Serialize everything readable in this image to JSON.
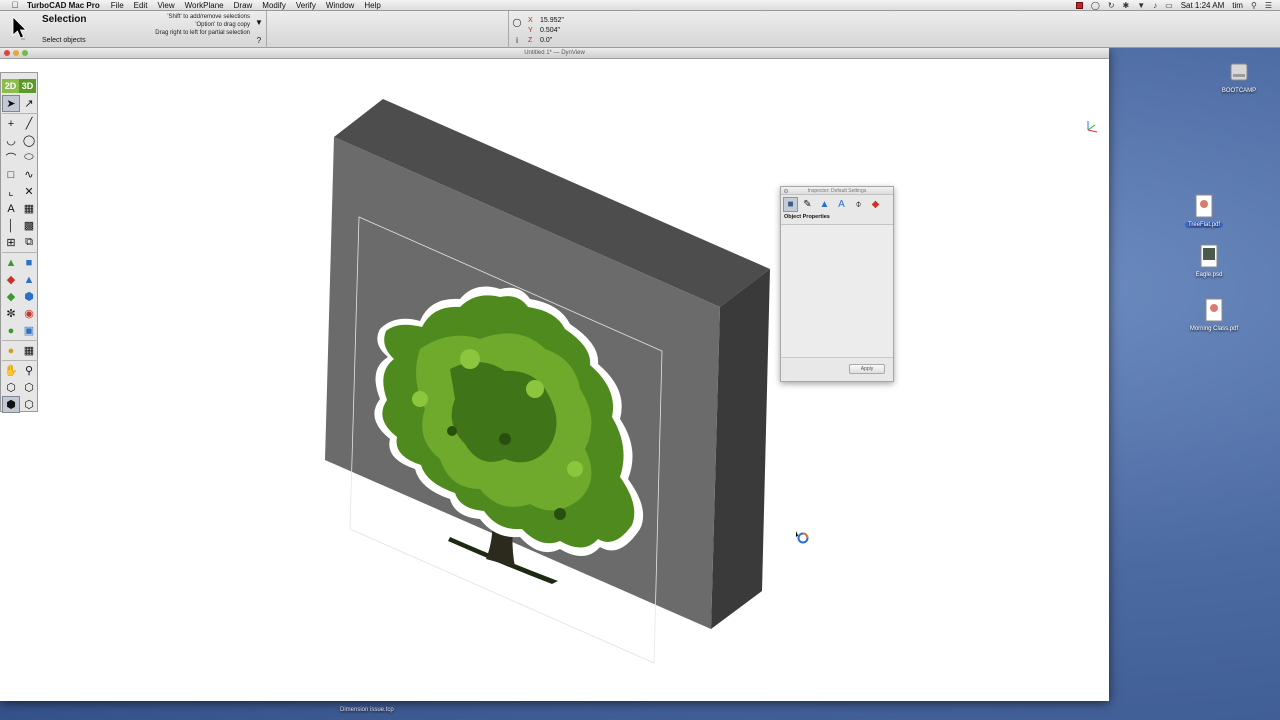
{
  "menubar": {
    "app_name": "TurboCAD Mac Pro",
    "menus": [
      "File",
      "Edit",
      "View",
      "WorkPlane",
      "Draw",
      "Modify",
      "Verify",
      "Window",
      "Help"
    ],
    "clock": "Sat 1:24 AM",
    "user": "tim"
  },
  "toolbar": {
    "tool_title": "Selection",
    "tool_subtitle": "Select objects",
    "hints": [
      "'Shift' to add/remove selections",
      "'Option' to drag copy",
      "Drag right to left for partial selection"
    ],
    "coords": [
      {
        "label": "X",
        "value": "15.952\""
      },
      {
        "label": "Y",
        "value": "0.504\""
      },
      {
        "label": "Z",
        "value": "0.0\""
      }
    ]
  },
  "window": {
    "title": "Untitled 1* — DynView"
  },
  "palette": {
    "mode_2d": "2D",
    "mode_3d": "3D"
  },
  "inspector": {
    "title": "Inspector: Default Settings",
    "section": "Object Properties",
    "apply_label": "Apply"
  },
  "desktop": {
    "icons": [
      {
        "label": "BOOTCAMP",
        "kind": "drive-icon"
      },
      {
        "label": "TreeFlat.pdf",
        "kind": "pdf-file-icon",
        "selected": true
      },
      {
        "label": "Eagle.psd",
        "kind": "psd-file-icon"
      },
      {
        "label": "Morning Class.pdf",
        "kind": "pdf-file-icon"
      }
    ],
    "partial_top_label": "...",
    "bottom_label": "Dimension issue.tcp"
  },
  "colors": {
    "mode_2d": "#8cbd4a",
    "mode_3d": "#5b9a2a",
    "coord_label": "#cc1f1f",
    "box_front": "#6b6b6b",
    "box_top": "#4c4c4c",
    "box_side": "#3c3c3c"
  }
}
